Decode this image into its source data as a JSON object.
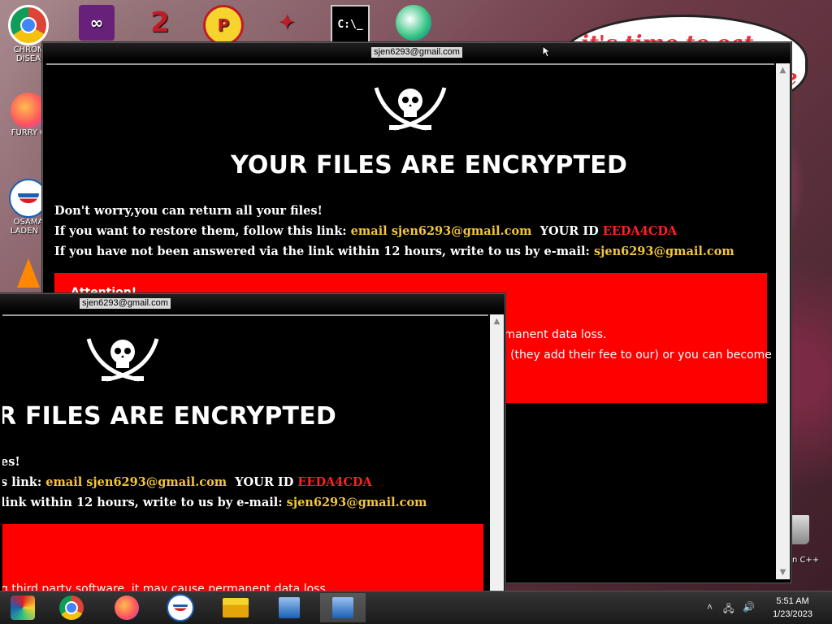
{
  "desktop": {
    "icons": [
      {
        "label": "CHRON DISEA",
        "icon": "chrome-icon"
      },
      {
        "label": "FURRY C",
        "icon": "firefox-icon"
      },
      {
        "label": "OSAMA LADEN B",
        "icon": "obama-logo-icon"
      },
      {
        "label": "",
        "icon": "vlc-icon"
      }
    ],
    "top_icons": [
      "visual-studio-icon",
      "app-2-icon",
      "p-app-icon",
      "wolf-icon",
      "cmd-icon",
      "bowling-icon"
    ],
    "bubble_text": "it's time to eat shit",
    "bubble_fragment": "te",
    "right_label": "n C++"
  },
  "window_back": {
    "title": "sjen6293@gmail.com",
    "headline": "YOUR FILES ARE ENCRYPTED",
    "line1": "Don't worry,you can return all your files!",
    "line2_prefix": "If you want to restore them, follow this link:",
    "line2_email": "email sjen6293@gmail.com",
    "line2_id_label": "YOUR ID",
    "line2_id": "EEDA4CDA",
    "line3_prefix": "If you have not been answered via the link within 12 hours, write to us by e-mail:",
    "line3_email": "sjen6293@gmail.com",
    "box_title": "Attention!",
    "box_line1": "rmanent data loss.",
    "box_line2": "e (they add their fee to our) or you can become"
  },
  "window_front": {
    "title": "sjen6293@gmail.com",
    "headline": "R FILES ARE ENCRYPTED",
    "line1": "es!",
    "line2_prefix": "s link:",
    "line2_email": "email sjen6293@gmail.com",
    "line2_id_label": "YOUR ID",
    "line2_id": "EEDA4CDA",
    "line3_prefix": "link within 12 hours, write to us by e-mail:",
    "line3_email": "sjen6293@gmail.com",
    "box_bottom": "g third party software, it may cause permanent data loss."
  },
  "taskbar": {
    "buttons": [
      "app-colorful-icon",
      "chrome-icon",
      "firefox-icon",
      "obama-logo-icon",
      "file-explorer-icon",
      "installer-icon",
      "installer-icon"
    ],
    "time": "5:51 AM",
    "date": "1/23/2023"
  },
  "colors": {
    "gold": "#f3c63a",
    "red_text": "#ff2020",
    "red_box": "#ff0000",
    "window_bg": "#000000"
  }
}
